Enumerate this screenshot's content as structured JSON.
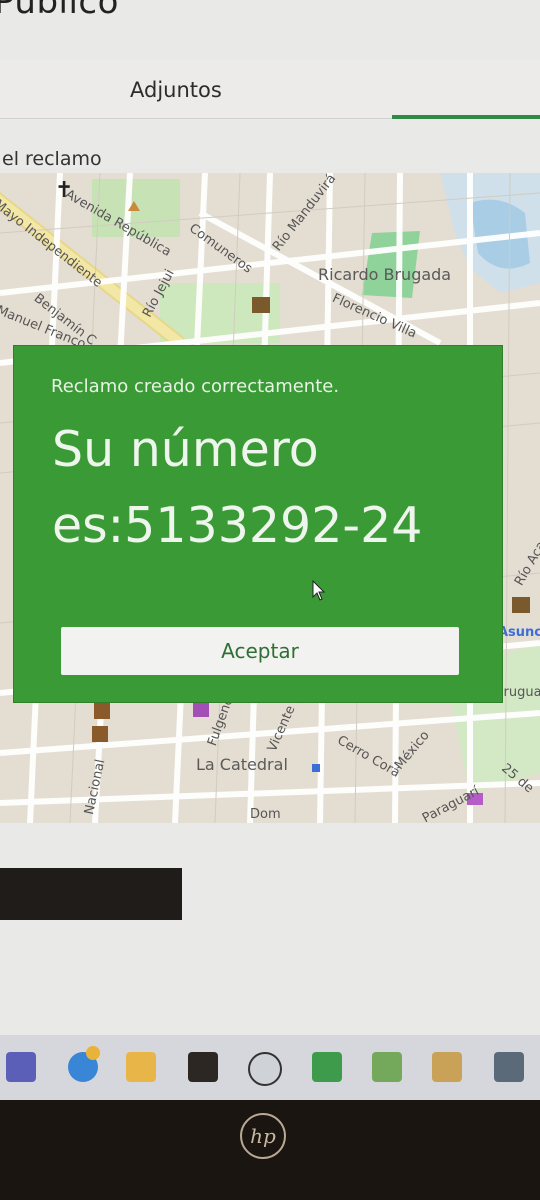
{
  "header": {
    "title": "Publico"
  },
  "tabs": {
    "adjuntos": "Adjuntos"
  },
  "map_section": {
    "label": "el reclamo",
    "streets": [
      "Avenida República",
      "Mayo Independiente",
      "Benjamín C",
      "Manuel Franco",
      "Comuneros",
      "Río Jejui",
      "Río Manduvirá",
      "Florencio Villa",
      "Ricardo Brugada",
      "La Catedral",
      "Vicente Ignacio",
      "Cerro Corá",
      "México",
      "Fulgencio",
      "Nacional",
      "Paraguarí",
      "Asunción",
      "Uruguay",
      "25 de",
      "Río Aca",
      "Dom"
    ]
  },
  "dialog": {
    "message": "Reclamo creado correctamente.",
    "number_text": "Su número\nes:5133292-24",
    "accept_label": "Aceptar"
  },
  "taskbar": {
    "icons": [
      "teams-icon",
      "help-icon",
      "file-explorer-icon",
      "sticky-notes-icon",
      "gauge-icon",
      "excel-icon",
      "sheet-icon",
      "snipping-tool-icon",
      "calculator-icon"
    ]
  },
  "device": {
    "brand_logo": "hp"
  },
  "colors": {
    "dialog_bg": "#3a9a35",
    "accent": "#2f8a46",
    "button_text": "#2f6f34"
  }
}
